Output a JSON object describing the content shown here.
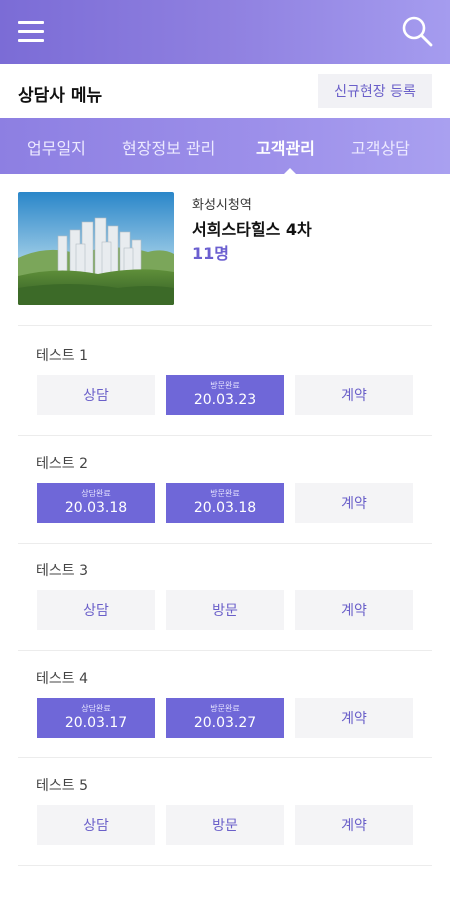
{
  "header": {
    "menu_icon": "hamburger-menu-icon",
    "search_icon": "search-icon",
    "gradient_start": "#7b6cd6",
    "gradient_end": "#a59cef"
  },
  "subheader": {
    "title": "상담사 메뉴",
    "register_button": "신규현장 등록"
  },
  "tabs": [
    {
      "label": "업무일지",
      "active": false
    },
    {
      "label": "현장정보 관리",
      "active": false
    },
    {
      "label": "고객관리",
      "active": true
    },
    {
      "label": "고객상담",
      "active": false
    }
  ],
  "site": {
    "region": "화성시청역",
    "name": "서희스타힐스 4차",
    "count": "11명"
  },
  "customers": [
    {
      "name": "테스트 1",
      "steps": [
        {
          "label": "상담",
          "done": false
        },
        {
          "label": "방문완료",
          "done": true,
          "date": "20.03.23"
        },
        {
          "label": "계약",
          "done": false
        }
      ]
    },
    {
      "name": "테스트 2",
      "steps": [
        {
          "label": "상담완료",
          "done": true,
          "date": "20.03.18"
        },
        {
          "label": "방문완료",
          "done": true,
          "date": "20.03.18"
        },
        {
          "label": "계약",
          "done": false
        }
      ]
    },
    {
      "name": "테스트 3",
      "steps": [
        {
          "label": "상담",
          "done": false
        },
        {
          "label": "방문",
          "done": false
        },
        {
          "label": "계약",
          "done": false
        }
      ]
    },
    {
      "name": "테스트 4",
      "steps": [
        {
          "label": "상담완료",
          "done": true,
          "date": "20.03.17"
        },
        {
          "label": "방문완료",
          "done": true,
          "date": "20.03.27"
        },
        {
          "label": "계약",
          "done": false
        }
      ]
    },
    {
      "name": "테스트 5",
      "steps": [
        {
          "label": "상담",
          "done": false
        },
        {
          "label": "방문",
          "done": false
        },
        {
          "label": "계약",
          "done": false
        }
      ]
    }
  ],
  "colors": {
    "accent": "#6f67d8",
    "accent_text": "#6a5fc9",
    "step_inactive_bg": "#f4f4f6"
  }
}
